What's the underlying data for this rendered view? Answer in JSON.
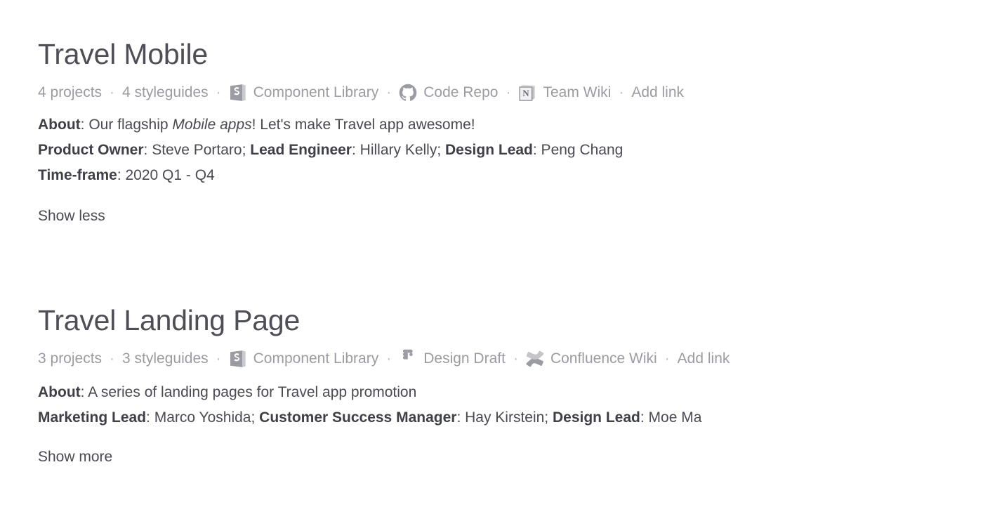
{
  "projects": [
    {
      "title": "Travel Mobile",
      "meta": {
        "projects_count": "4 projects",
        "styleguides_count": "4 styleguides",
        "links": [
          {
            "icon": "storybook-icon",
            "label": "Component Library"
          },
          {
            "icon": "github-icon",
            "label": "Code Repo"
          },
          {
            "icon": "notion-icon",
            "label": "Team Wiki"
          }
        ],
        "add_link_label": "Add link",
        "separator": "·"
      },
      "about": {
        "label": "About",
        "text_before_em": ": Our flagship ",
        "emphasis": "Mobile apps",
        "text_after_em": "! Let's make Travel app awesome!"
      },
      "people": [
        {
          "role": "Product Owner",
          "name": ": Steve Portaro; "
        },
        {
          "role": "Lead Engineer",
          "name": ": Hillary Kelly; "
        },
        {
          "role": "Design Lead",
          "name": ": Peng Chang"
        }
      ],
      "timeframe": {
        "label": "Time-frame",
        "value": ": 2020 Q1 - Q4"
      },
      "toggle_label": "Show less"
    },
    {
      "title": "Travel Landing Page",
      "meta": {
        "projects_count": "3 projects",
        "styleguides_count": "3 styleguides",
        "links": [
          {
            "icon": "storybook-icon",
            "label": "Component Library"
          },
          {
            "icon": "figma-icon",
            "label": "Design Draft"
          },
          {
            "icon": "confluence-icon",
            "label": "Confluence Wiki"
          }
        ],
        "add_link_label": "Add link",
        "separator": "·"
      },
      "about": {
        "label": "About",
        "text_before_em": ": A series of landing pages for Travel app promotion",
        "emphasis": "",
        "text_after_em": ""
      },
      "people": [
        {
          "role": "Marketing Lead",
          "name": ": Marco Yoshida; "
        },
        {
          "role": "Customer Success Manager",
          "name": ": Hay Kirstein; "
        },
        {
          "role": "Design Lead",
          "name": ": Moe Ma"
        }
      ],
      "timeframe": null,
      "toggle_label": "Show more"
    }
  ],
  "colors": {
    "title": "#4e4e57",
    "body_text": "#4a4a54",
    "muted_text": "#9b9ba3",
    "icon_gray": "#9b9ba3",
    "background": "#ffffff"
  }
}
